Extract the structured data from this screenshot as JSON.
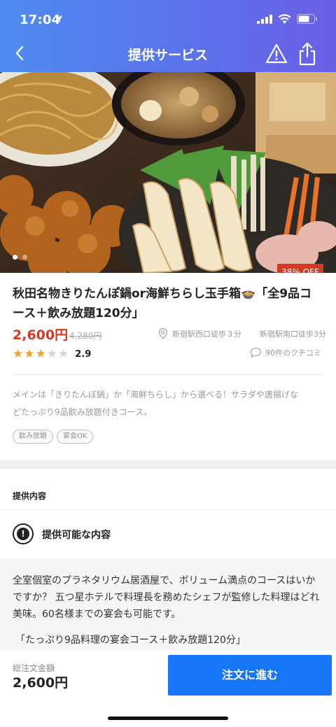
{
  "status_bar": {
    "time": "17:04"
  },
  "nav": {
    "title": "提供サービス"
  },
  "hero": {
    "discount_badge": "38% OFF"
  },
  "listing": {
    "title_line1": "秋田名物きりたんぽ鍋or海鮮ちらし玉手箱🍲「全9品コ",
    "title_line2": "ース＋飲み放題120分」",
    "price": "2,600円",
    "original_price": "4,280円",
    "access": [
      "新宿駅西口徒歩３分",
      "新宿駅南口徒歩3分"
    ],
    "rating": {
      "value": "2.9",
      "stars": 3,
      "max": 5
    },
    "reviews": "90件のクチコミ",
    "description_line1": "メインは「きりたんぽ鍋」か「海鮮ちらし」から選べる！サラダや唐揚げな",
    "description_line2": "どたっぷり9品飲み放題付きコース。",
    "tags": [
      "飲み放題",
      "宴会OK"
    ]
  },
  "contents": {
    "section_label": "提供内容",
    "available_title": "提供可能な内容",
    "detail_line1": "全室個室のプラネタリウム居酒屋で、ボリューム満点のコースはいか",
    "detail_line2": "ですか？ 五つ星ホテルで料理長を務めたシェフが監修した料理はどれ",
    "detail_line3": "美味。60名様までの宴会も可能です。",
    "detail_quote": "「たっぷり9品料理の宴会コース＋飲み放題120分」"
  },
  "footer": {
    "total_label": "総注文金額",
    "total_price": "2,600円",
    "order_button": "注文に進む"
  },
  "colors": {
    "header_gradient": [
      "#4f8bf0",
      "#6a5fe6"
    ],
    "price": "#d23a24",
    "badge": "#d23a24",
    "primary_button": "#1577f5",
    "star_on": "#f1a228"
  },
  "icons": {
    "back": "chevron-left-icon",
    "alert": "warning-triangle-icon",
    "share": "share-icon",
    "location": "map-pin-icon",
    "review": "speech-bubble-icon",
    "available": "exclamation-circle-icon"
  }
}
